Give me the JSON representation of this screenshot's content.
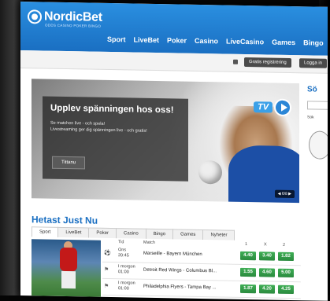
{
  "brand": {
    "name": "NordicBet",
    "tagline": "ODDS CASINO POKER BINGO"
  },
  "nav": [
    "Sport",
    "LiveBet",
    "Poker",
    "Casino",
    "LiveCasino",
    "Games",
    "Bingo"
  ],
  "account": {
    "register_label": "Gratis registrering",
    "login_label": "Logga in"
  },
  "hero": {
    "title": "Upplev spänningen hos oss!",
    "line1": "Se matchen live - och spela!",
    "line2": "Livestreaming ger dig spänningen live - och gratis!",
    "cta": "Tittanu",
    "tv_label": "TV",
    "pager": "◀ 6/8 ▶"
  },
  "side": {
    "title": "Sö",
    "option": "Sök"
  },
  "hot": {
    "title": "Hetast Just Nu",
    "tabs": [
      "Sport",
      "LiveBet",
      "Poker",
      "Casino",
      "Bingo",
      "Games",
      "Nyheter"
    ],
    "columns": {
      "time": "Tid",
      "match": "Match",
      "c1": "1",
      "cx": "X",
      "c2": "2"
    },
    "rows": [
      {
        "time": "Ons 20:45",
        "match": "Marseille - Bayern München",
        "odds": [
          "4.40",
          "3.40",
          "1.82"
        ]
      },
      {
        "time": "I morgon 01:00",
        "match": "Detroit Red Wings - Columbus Bl...",
        "odds": [
          "1.55",
          "4.60",
          "5.00"
        ]
      },
      {
        "time": "I morgon 01:00",
        "match": "Philadelphia Flyers - Tampa Bay ...",
        "odds": [
          "1.87",
          "4.20",
          "4.25"
        ]
      }
    ]
  },
  "colors": {
    "header": "#1a6fc2",
    "odds": "#2a8a3e",
    "title": "#1a6fc2"
  }
}
